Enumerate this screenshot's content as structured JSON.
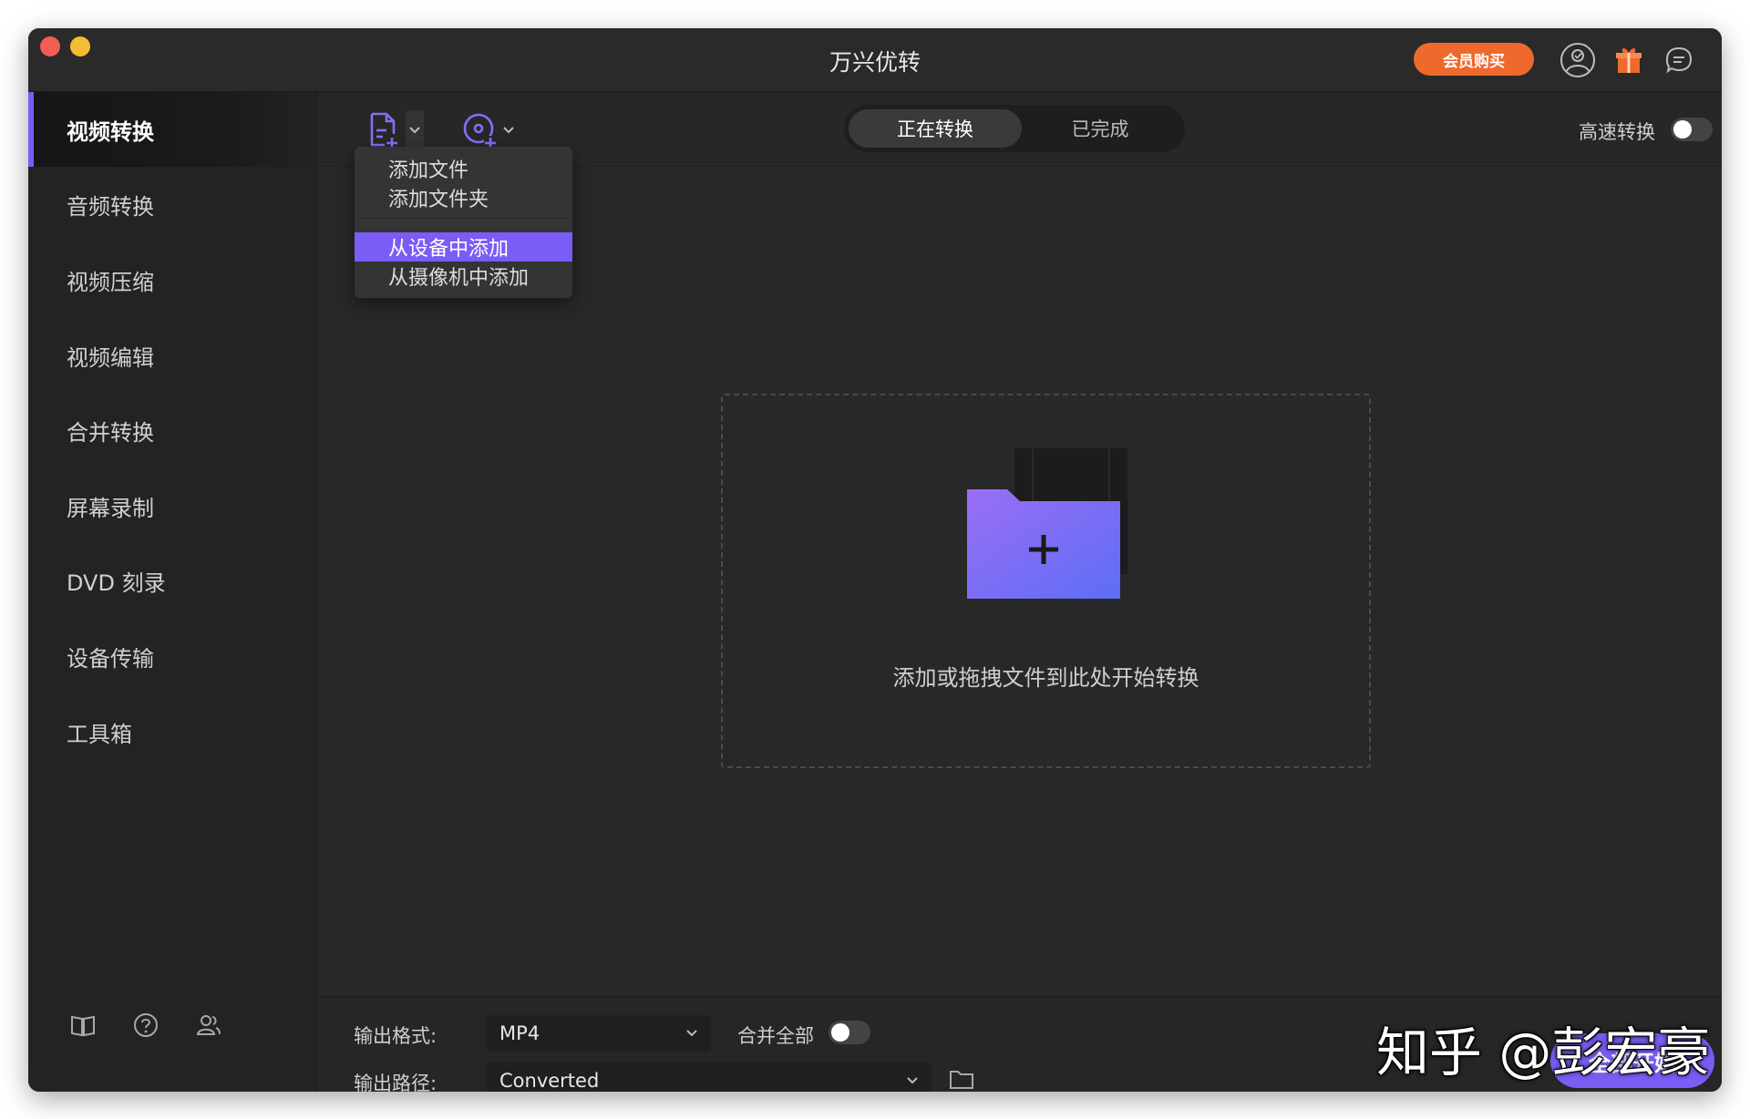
{
  "window": {
    "title": "万兴优转",
    "vip_label": "会员购买"
  },
  "sidebar": {
    "items": [
      {
        "label": "视频转换"
      },
      {
        "label": "音频转换"
      },
      {
        "label": "视频压缩"
      },
      {
        "label": "视频编辑"
      },
      {
        "label": "合并转换"
      },
      {
        "label": "屏幕录制"
      },
      {
        "label": "DVD 刻录"
      },
      {
        "label": "设备传输"
      },
      {
        "label": "工具箱"
      }
    ],
    "footer_icons": [
      "book-icon",
      "help-icon",
      "users-icon"
    ]
  },
  "toolbar": {
    "add_file_icon": "add-file-icon",
    "add_dvd_icon": "add-dvd-icon",
    "tabs": [
      {
        "label": "正在转换"
      },
      {
        "label": "已完成"
      }
    ],
    "speed_label": "高速转换"
  },
  "add_menu": {
    "items": [
      {
        "label": "添加文件"
      },
      {
        "label": "添加文件夹"
      },
      {
        "label": "从设备中添加"
      },
      {
        "label": "从摄像机中添加"
      }
    ]
  },
  "dropzone": {
    "hint": "添加或拖拽文件到此处开始转换"
  },
  "footer": {
    "format_label": "输出格式:",
    "format_value": "MP4",
    "merge_label": "合并全部",
    "path_label": "输出路径:",
    "path_value": "Converted",
    "start_label": "全部开始"
  },
  "watermark": "知乎 @彭宏豪",
  "colors": {
    "accent": "#7b5cf5",
    "vip": "#f0692c",
    "gift": "#f0692c"
  }
}
